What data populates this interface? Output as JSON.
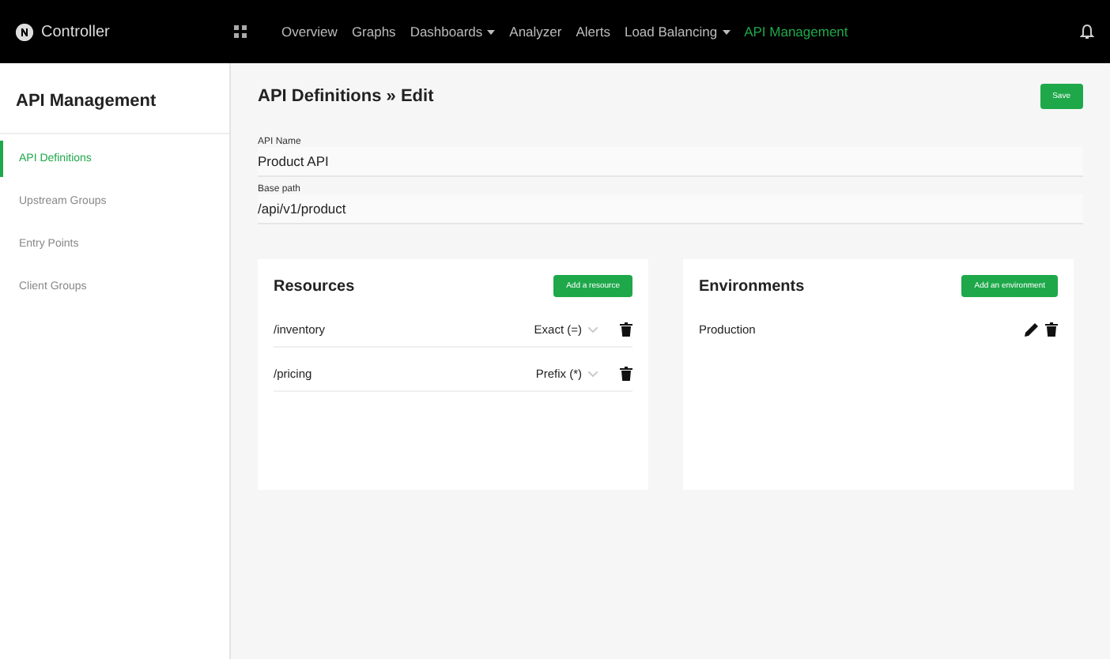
{
  "brand": {
    "name": "Controller"
  },
  "nav": [
    {
      "label": "Overview",
      "selected": false,
      "dropdown": false
    },
    {
      "label": "Graphs",
      "selected": false,
      "dropdown": false
    },
    {
      "label": "Dashboards",
      "selected": false,
      "dropdown": true
    },
    {
      "label": "Analyzer",
      "selected": false,
      "dropdown": false
    },
    {
      "label": "Alerts",
      "selected": false,
      "dropdown": false
    },
    {
      "label": "Load Balancing",
      "selected": false,
      "dropdown": true
    },
    {
      "label": "API Management",
      "selected": true,
      "dropdown": false
    }
  ],
  "sidebar": {
    "title": "API Management",
    "items": [
      {
        "label": "API Definitions",
        "selected": true
      },
      {
        "label": "Upstream Groups",
        "selected": false
      },
      {
        "label": "Entry Points",
        "selected": false
      },
      {
        "label": "Client Groups",
        "selected": false
      }
    ]
  },
  "page": {
    "breadcrumb": "API Definitions » Edit",
    "save_button": "Save"
  },
  "fields": [
    {
      "label": "API Name",
      "value": "Product API"
    },
    {
      "label": "Base path",
      "value": "/api/v1/product"
    }
  ],
  "resources": {
    "title": "Resources",
    "add_button": "Add a resource",
    "rows": [
      {
        "path": "/inventory",
        "match": "Exact (=)"
      },
      {
        "path": "/pricing",
        "match": "Prefix (*)"
      }
    ]
  },
  "environments": {
    "title": "Environments",
    "add_button": "Add an environment",
    "rows": [
      {
        "name": "Production"
      }
    ]
  }
}
